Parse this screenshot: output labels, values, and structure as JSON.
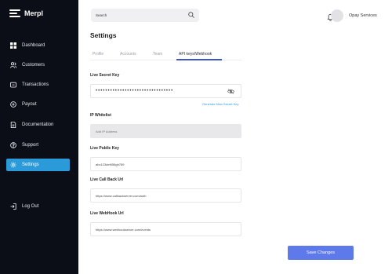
{
  "brand": {
    "name": "Merpl"
  },
  "sidebar": {
    "items": [
      {
        "label": "Dashboard",
        "icon": "dashboard-icon"
      },
      {
        "label": "Customers",
        "icon": "customers-icon"
      },
      {
        "label": "Transactions",
        "icon": "transactions-icon"
      },
      {
        "label": "Payout",
        "icon": "payout-icon"
      },
      {
        "label": "Documentation",
        "icon": "documentation-icon"
      },
      {
        "label": "Support",
        "icon": "support-icon"
      },
      {
        "label": "Settings",
        "icon": "settings-icon",
        "active": true
      }
    ],
    "logout_label": "Log Out"
  },
  "header": {
    "search_placeholder": "Search",
    "username": "Opay Services"
  },
  "page": {
    "title": "Settings",
    "tabs": [
      {
        "label": "Profile"
      },
      {
        "label": "Accounts"
      },
      {
        "label": "Team"
      },
      {
        "label": "API keys/Webhook",
        "active": true
      }
    ]
  },
  "form": {
    "live_secret_key": {
      "label": "Live Secret Key",
      "value": "••••••••••••••••••••••••••••••••"
    },
    "generate_link": "Generate New Secret Key",
    "ip_whitelist": {
      "label": "IP Whitelist",
      "placeholder": "Add IP Address"
    },
    "live_public_key": {
      "label": "Live Public Key",
      "value": "abc123def456gh789"
    },
    "live_callback_url": {
      "label": "Live Call Back Url",
      "value": "https://www.callbackserver.com/auth"
    },
    "live_webhook_url": {
      "label": "Live WebHook Url",
      "value": "https://www.webhookserver.com/events"
    },
    "save_label": "Save Changes"
  },
  "colors": {
    "sidebar_bg": "#0b0d17",
    "accent": "#2b9ad8",
    "button": "#5e79ea",
    "tab_underline": "#3d55c9"
  }
}
